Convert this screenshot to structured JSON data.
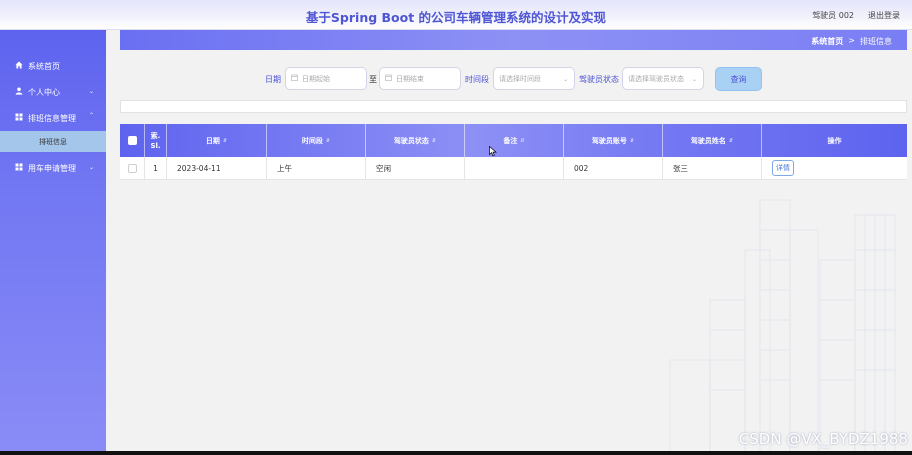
{
  "header": {
    "title": "基于Spring Boot 的公司车辆管理系统的设计及实现",
    "user": "驾驶员 002",
    "logout": "退出登录"
  },
  "sidebar": {
    "items": [
      {
        "label": "系统首页",
        "icon": "home-icon"
      },
      {
        "label": "个人中心",
        "icon": "user-icon"
      },
      {
        "label": "排班信息管理",
        "icon": "grid-icon"
      },
      {
        "label": "用车申请管理",
        "icon": "grid-icon"
      }
    ],
    "submenu": {
      "label": "排班信息"
    }
  },
  "breadcrumb": {
    "home": "系统首页",
    "separator": ">",
    "current": "排班信息"
  },
  "search": {
    "date_label": "日期",
    "date_start_placeholder": "日期起始",
    "to": "至",
    "date_end_placeholder": "日期结束",
    "period_label": "时间段",
    "period_placeholder": "请选择时间段",
    "status_label": "驾驶员状态",
    "status_placeholder": "请选择驾驶员状态",
    "query_button": "查询"
  },
  "table": {
    "headers": [
      "索.\nSl.",
      "日期",
      "时间段",
      "驾驶员状态",
      "备注",
      "驾驶员账号",
      "驾驶员姓名",
      "操作"
    ],
    "rows": [
      {
        "index": "1",
        "date": "2023-04-11",
        "period": "上午",
        "status": "空闲",
        "note": "",
        "account": "002",
        "name": "张三",
        "action": "详情"
      }
    ]
  },
  "watermark": "CSDN @VX_BYDZ1988",
  "colors": {
    "accent": "#5e63ef",
    "title": "#4f56d4",
    "query": "#a9d1f3",
    "submenu": "#a4c6ea"
  }
}
